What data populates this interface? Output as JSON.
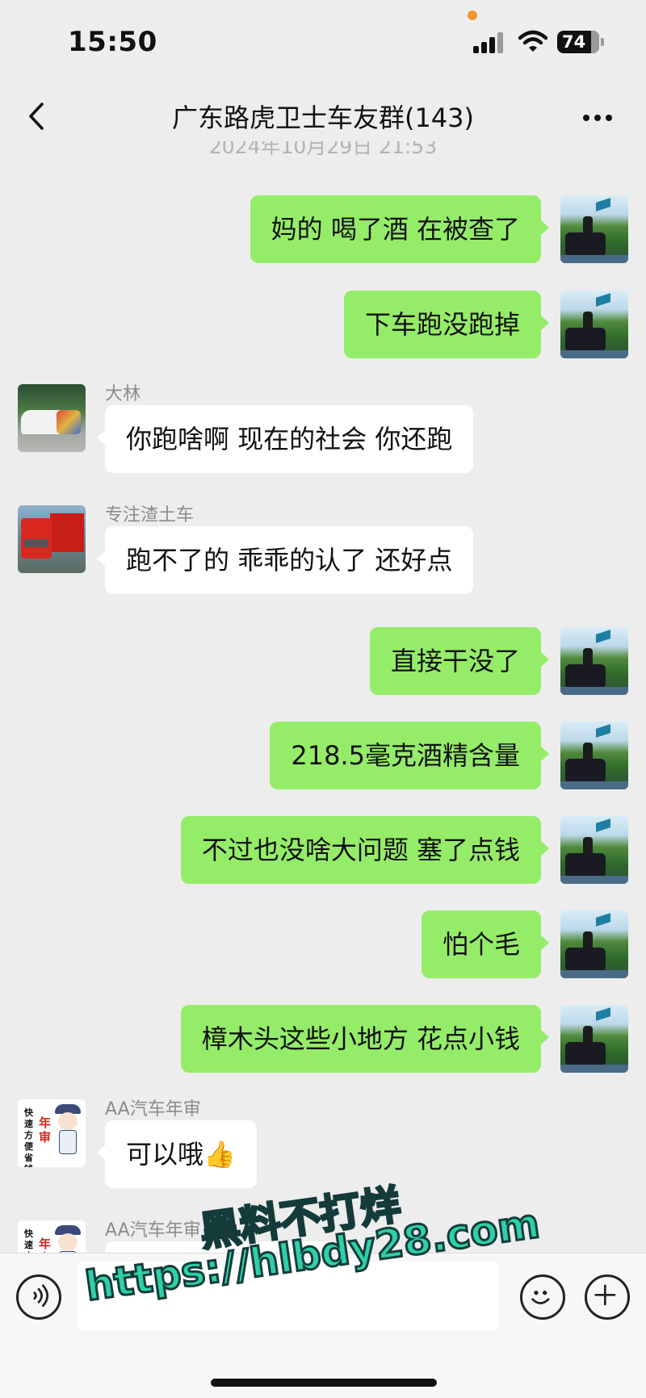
{
  "status_bar": {
    "time": "15:50",
    "battery": "74",
    "recording_dot_color": "#f2952c"
  },
  "nav": {
    "title": "广东路虎卫士车友群(143)",
    "back_icon": "chevron-left-icon",
    "more_icon": "more-dots-icon"
  },
  "timestamp": "2024年10月29日 21:53",
  "messages": [
    {
      "side": "right",
      "text": "妈的 喝了酒 在被查了"
    },
    {
      "side": "right",
      "text": "下车跑没跑掉"
    },
    {
      "side": "left",
      "sender": "大林",
      "text": "你跑啥啊 现在的社会 你还跑"
    },
    {
      "side": "left",
      "sender": "专注渣土车",
      "text": "跑不了的 乖乖的认了 还好点"
    },
    {
      "side": "right",
      "text": "直接干没了"
    },
    {
      "side": "right",
      "text": "218.5毫克酒精含量"
    },
    {
      "side": "right",
      "text": "不过也没啥大问题 塞了点钱"
    },
    {
      "side": "right",
      "text": "怕个毛"
    },
    {
      "side": "right",
      "text": "樟木头这些小地方 花点小钱"
    },
    {
      "side": "left",
      "sender": "AA汽车年审",
      "text": "可以哦👍"
    },
    {
      "side": "left",
      "sender": "AA汽车年审",
      "text": ""
    }
  ],
  "avatar_aa": {
    "text_black": "快速方便省钱",
    "text_red": "年审"
  },
  "composer": {
    "voice_icon": "voice-icon",
    "emoji_icon": "emoji-icon",
    "plus_icon": "plus-icon"
  },
  "watermark": {
    "line1": "黑料不打烊",
    "line2": "https://hlbdy28.com"
  },
  "colors": {
    "self_bubble": "#95ec69",
    "other_bubble": "#ffffff",
    "background": "#ededed"
  }
}
